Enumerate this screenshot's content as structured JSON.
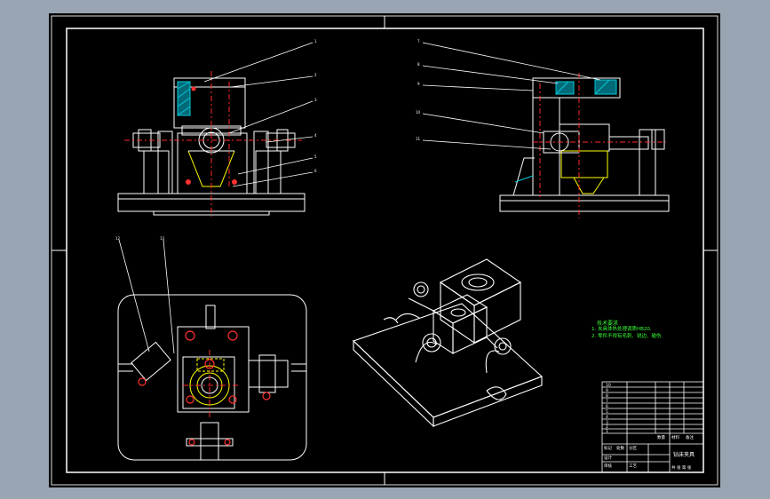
{
  "app": {
    "window_bg": "#9aa5b3",
    "sheet_bg": "#000000"
  },
  "colors": {
    "outline": "#ffffff",
    "centerline": "#ff2a2a",
    "section_hatch": "#00c8d8",
    "hidden_part": "#ffff00",
    "notes_text": "#35ff35",
    "bolt_marks": "#ff3030"
  },
  "drawing": {
    "balloon_labels_front": [
      "1",
      "2",
      "3",
      "4",
      "5",
      "6"
    ],
    "balloon_labels_side": [
      "7",
      "8",
      "9",
      "10",
      "11"
    ],
    "balloon_labels_top": [
      "12",
      "13"
    ],
    "notes": {
      "heading": "技术要求",
      "lines": [
        "1. 夹具体热处理调质HB20.",
        "2. 零件不得有毛刺、锐边、碰伤."
      ]
    },
    "title_block": {
      "left_rows": [
        "10",
        "9",
        "8",
        "7",
        "6",
        "5",
        "4",
        "3",
        "2",
        "1"
      ],
      "right_cols": [
        "数量",
        "材料",
        "备注"
      ],
      "bottom_labels": [
        "标记",
        "处数",
        "分区",
        "设计",
        "审核",
        "工艺"
      ],
      "title": "钻床夹具",
      "sheet": "共 张 第 张"
    }
  }
}
